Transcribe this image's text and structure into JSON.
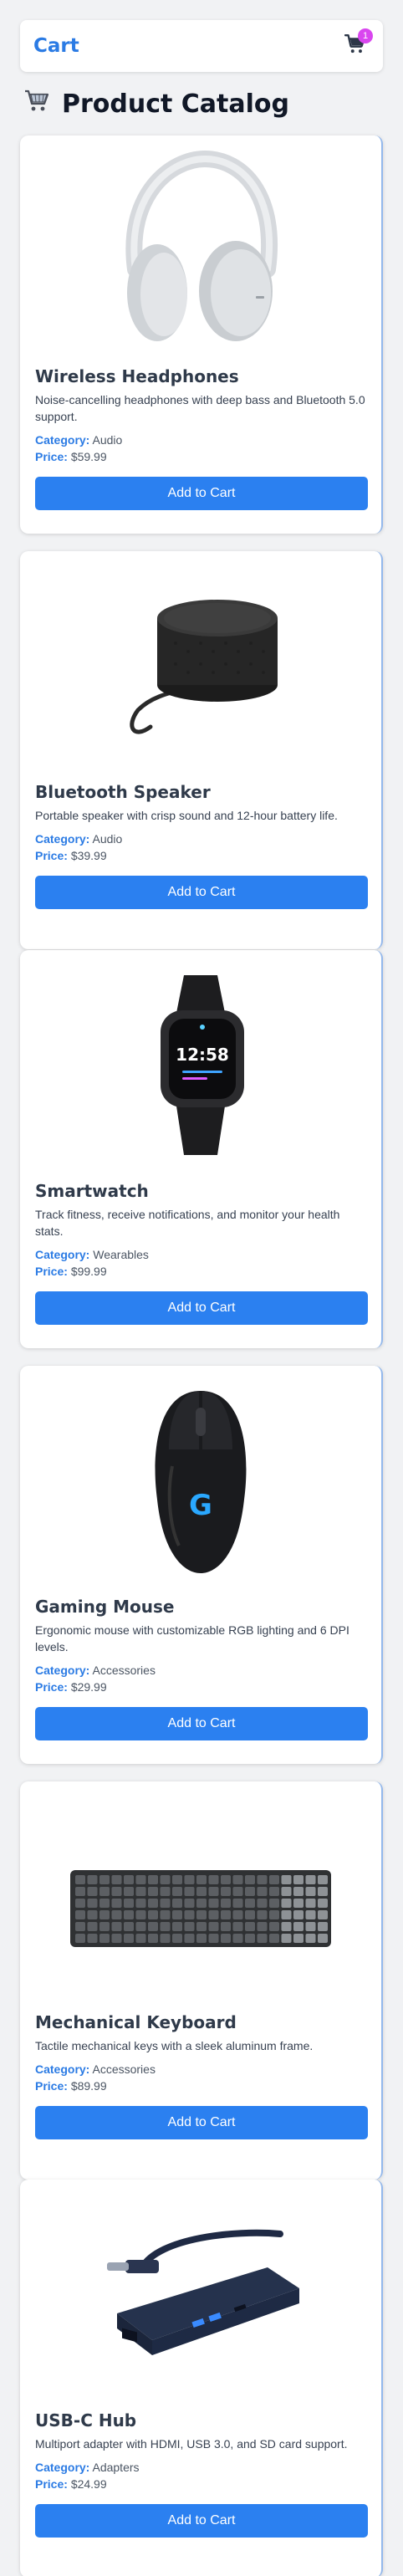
{
  "header": {
    "cart_label": "Cart",
    "cart_count": "1"
  },
  "catalog": {
    "title": "Product Catalog"
  },
  "products": [
    {
      "name": "Wireless Headphones",
      "description": "Noise-cancelling headphones with deep bass and Bluetooth 5.0 support.",
      "category_label": "Category:",
      "category": "Audio",
      "price_label": "Price:",
      "price": "$59.99",
      "button_label": "Add to Cart",
      "image_icon": "headphones-image"
    },
    {
      "name": "Bluetooth Speaker",
      "description": "Portable speaker with crisp sound and 12-hour battery life.",
      "category_label": "Category:",
      "category": "Audio",
      "price_label": "Price:",
      "price": "$39.99",
      "button_label": "Add to Cart",
      "image_icon": "speaker-image"
    },
    {
      "name": "Smartwatch",
      "description": "Track fitness, receive notifications, and monitor your health stats.",
      "category_label": "Category:",
      "category": "Wearables",
      "price_label": "Price:",
      "price": "$99.99",
      "button_label": "Add to Cart",
      "image_icon": "smartwatch-image",
      "watch_time": "12:58"
    },
    {
      "name": "Gaming Mouse",
      "description": "Ergonomic mouse with customizable RGB lighting and 6 DPI levels.",
      "category_label": "Category:",
      "category": "Accessories",
      "price_label": "Price:",
      "price": "$29.99",
      "button_label": "Add to Cart",
      "image_icon": "mouse-image"
    },
    {
      "name": "Mechanical Keyboard",
      "description": "Tactile mechanical keys with a sleek aluminum frame.",
      "category_label": "Category:",
      "category": "Accessories",
      "price_label": "Price:",
      "price": "$89.99",
      "button_label": "Add to Cart",
      "image_icon": "keyboard-image"
    },
    {
      "name": "USB-C Hub",
      "description": "Multiport adapter with HDMI, USB 3.0, and SD card support.",
      "category_label": "Category:",
      "category": "Adapters",
      "price_label": "Price:",
      "price": "$24.99",
      "button_label": "Add to Cart",
      "image_icon": "usb-hub-image"
    }
  ],
  "colors": {
    "accent": "#2b7be4",
    "button": "#2b80f0",
    "badge": "#d946ef",
    "background": "#f1f2f4"
  }
}
